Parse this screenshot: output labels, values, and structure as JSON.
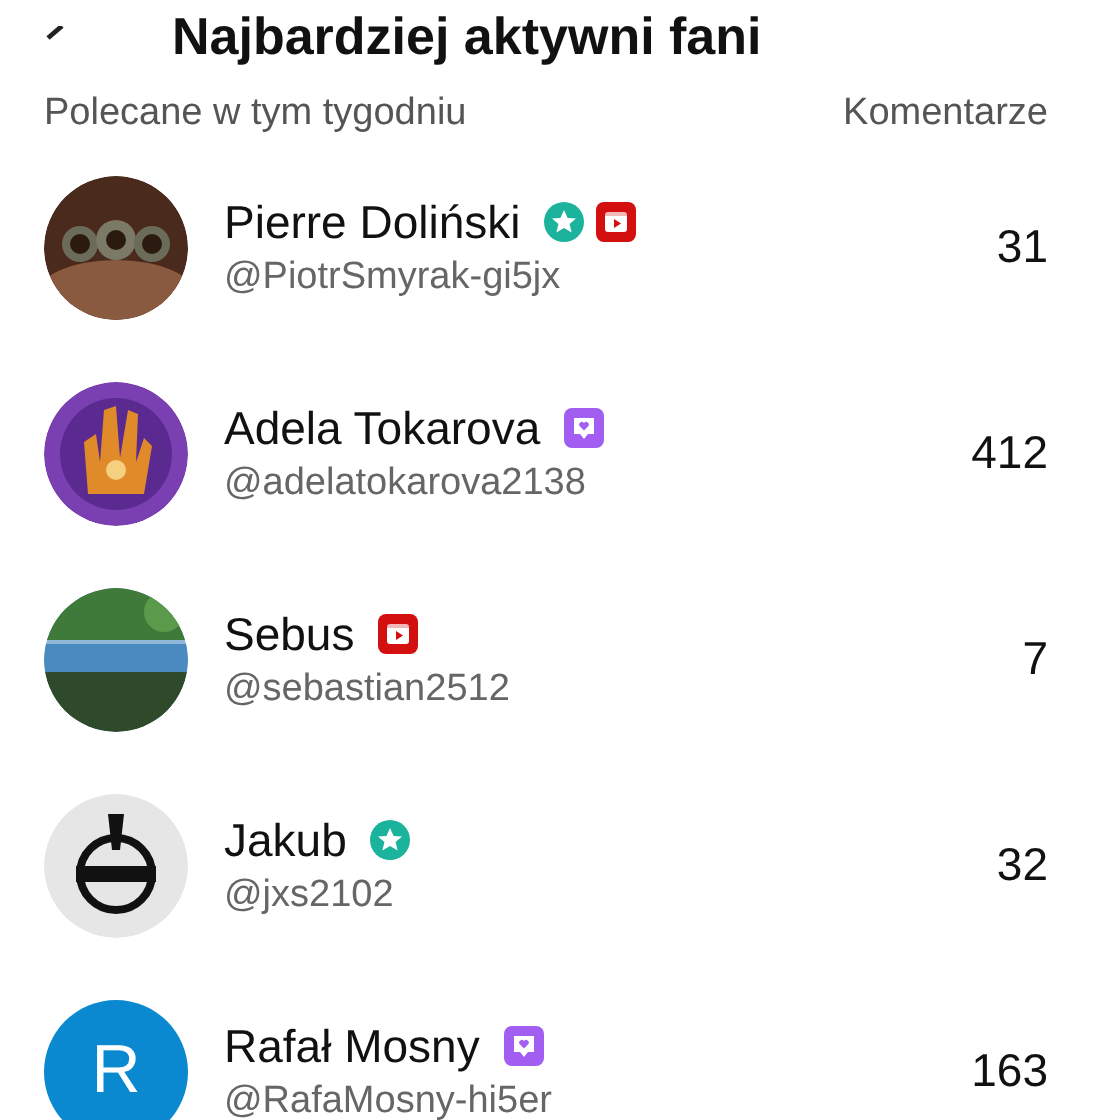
{
  "header": {
    "title": "Najbardziej aktywni fani"
  },
  "list_header": {
    "left": "Polecane w tym tygodniu",
    "right": "Komentarze"
  },
  "fans": [
    {
      "avatar": {
        "kind": "picture"
      },
      "name": "Pierre Doliński",
      "badges": [
        {
          "kind": "star"
        },
        {
          "kind": "video"
        }
      ],
      "handle": "@PiotrSmyrak-gi5jx",
      "count": "31"
    },
    {
      "avatar": {
        "kind": "picture"
      },
      "name": "Adela Tokarova",
      "badges": [
        {
          "kind": "chat"
        }
      ],
      "handle": "@adelatokarova2138",
      "count": "412"
    },
    {
      "avatar": {
        "kind": "picture"
      },
      "name": "Sebus",
      "badges": [
        {
          "kind": "video"
        }
      ],
      "handle": "@sebastian2512",
      "count": "7"
    },
    {
      "avatar": {
        "kind": "picture"
      },
      "name": "Jakub",
      "badges": [
        {
          "kind": "star"
        }
      ],
      "handle": "@jxs2102",
      "count": "32"
    },
    {
      "avatar": {
        "kind": "letter",
        "letter": "R",
        "color": "#0a88d0"
      },
      "name": "Rafał Mosny",
      "badges": [
        {
          "kind": "chat"
        }
      ],
      "handle": "@RafaMosny-hi5er",
      "count": "163"
    }
  ]
}
